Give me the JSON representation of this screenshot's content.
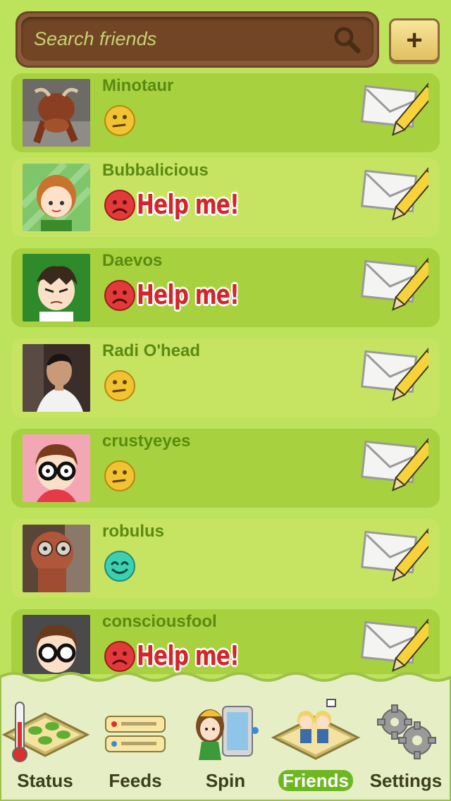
{
  "search": {
    "placeholder": "Search friends"
  },
  "header": {
    "add_label": "+"
  },
  "colors": {
    "background": "#bde25c",
    "row_dark": "#a7d13e",
    "row_light": "#c6e462",
    "name": "#5b8a12",
    "help": "#d3252a",
    "tabbar": "#e9f0c7"
  },
  "friends": [
    {
      "name": "Minotaur",
      "mood": "neutral-face-icon",
      "help": ""
    },
    {
      "name": "Bubbalicious",
      "mood": "sad-face-icon",
      "help": "Help me!"
    },
    {
      "name": "Daevos",
      "mood": "sad-face-icon",
      "help": "Help me!"
    },
    {
      "name": "Radi O'head",
      "mood": "neutral-face-icon",
      "help": ""
    },
    {
      "name": "crustyeyes",
      "mood": "neutral-face-icon",
      "help": ""
    },
    {
      "name": "robulus",
      "mood": "happy-face-icon",
      "help": ""
    },
    {
      "name": "consciousfool",
      "mood": "sad-face-icon",
      "help": "Help me!"
    }
  ],
  "tabs": [
    {
      "label": "Status",
      "icon": "farm-thermometer-icon"
    },
    {
      "label": "Feeds",
      "icon": "feeds-icon"
    },
    {
      "label": "Spin",
      "icon": "spin-icon"
    },
    {
      "label": "Friends",
      "icon": "friends-icon",
      "active": true
    },
    {
      "label": "Settings",
      "icon": "gears-icon"
    }
  ]
}
